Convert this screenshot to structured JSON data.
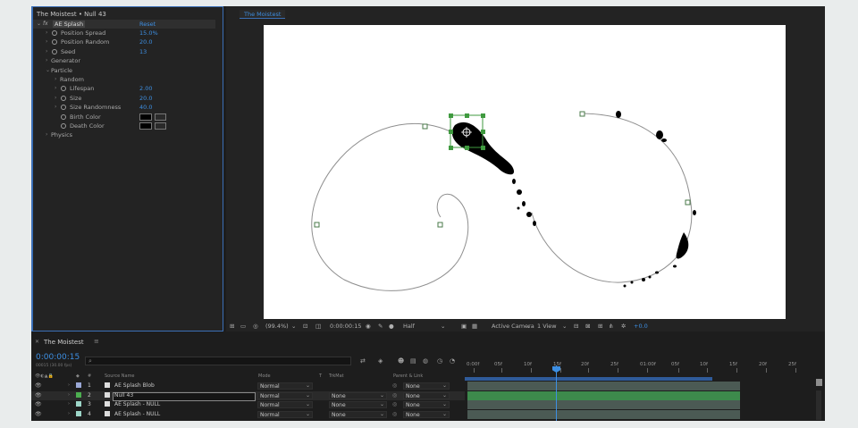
{
  "effect_controls": {
    "title": "The Moistest • Null 43",
    "effect_name": "AE Splash",
    "fx_label": "fx",
    "reset_label": "Reset",
    "params": [
      {
        "label": "Position Spread",
        "value": "15.0%",
        "indent": 1,
        "stopwatch": true,
        "twirl": true
      },
      {
        "label": "Position Random",
        "value": "20.0",
        "indent": 1,
        "stopwatch": true,
        "twirl": true
      },
      {
        "label": "Seed",
        "value": "13",
        "indent": 1,
        "stopwatch": true,
        "twirl": true
      },
      {
        "label": "Generator",
        "value": "",
        "indent": 1,
        "stopwatch": false,
        "twirl": true
      },
      {
        "label": "Particle",
        "value": "",
        "indent": 1,
        "stopwatch": false,
        "twirl": true,
        "open": true
      },
      {
        "label": "Random",
        "value": "",
        "indent": 2,
        "stopwatch": false,
        "twirl": true
      },
      {
        "label": "Lifespan",
        "value": "2.00",
        "indent": 2,
        "stopwatch": true,
        "twirl": true
      },
      {
        "label": "Size",
        "value": "20.0",
        "indent": 2,
        "stopwatch": true,
        "twirl": true
      },
      {
        "label": "Size Randomness",
        "value": "40.0",
        "indent": 2,
        "stopwatch": true,
        "twirl": true
      },
      {
        "label": "Birth Color",
        "value": "",
        "indent": 2,
        "stopwatch": true,
        "twirl": false,
        "color": "#000000"
      },
      {
        "label": "Death Color",
        "value": "",
        "indent": 2,
        "stopwatch": true,
        "twirl": false,
        "color": "#000000"
      },
      {
        "label": "Physics",
        "value": "",
        "indent": 1,
        "stopwatch": false,
        "twirl": true
      }
    ]
  },
  "viewer": {
    "tab": "The Moistest",
    "zoom": "(99.4%)",
    "timecode": "0:00:00:15",
    "resolution": "Half",
    "camera": "Active Camera",
    "views": "1 View",
    "exposure": "+0.0"
  },
  "timeline": {
    "tab": "The Moistest",
    "timecode": "0:00:00:15",
    "fps_text": "00015 (30.00 fps)",
    "search_placeholder": "",
    "columns": {
      "num": "#",
      "source": "Source Name",
      "mode": "Mode",
      "t": "T",
      "trkmat": "TrkMat",
      "parent": "Parent & Link"
    },
    "ruler_labels": [
      "0:00f",
      "05f",
      "10f",
      "15f",
      "20f",
      "25f",
      "01:00f",
      "05f",
      "10f",
      "15f",
      "20f",
      "25f"
    ],
    "layers": [
      {
        "num": "1",
        "name": "AE Splash Blob",
        "mode": "Normal",
        "trkmat": "",
        "parent": "None",
        "label_color": "#9aa8d6",
        "selected": false
      },
      {
        "num": "2",
        "name": "Null 43",
        "mode": "Normal",
        "trkmat": "None",
        "parent": "None",
        "label_color": "#4caf50",
        "selected": true
      },
      {
        "num": "3",
        "name": "AE Splash - NULL",
        "mode": "Normal",
        "trkmat": "None",
        "parent": "None",
        "label_color": "#9dd6c8",
        "selected": false
      },
      {
        "num": "4",
        "name": "AE Splash - NULL",
        "mode": "Normal",
        "trkmat": "None",
        "parent": "None",
        "label_color": "#9dd6c8",
        "selected": false
      }
    ]
  },
  "colors": {
    "accent": "#3d8fe3",
    "selection_track": "#3d8a4c",
    "panel_bg": "#232323"
  }
}
